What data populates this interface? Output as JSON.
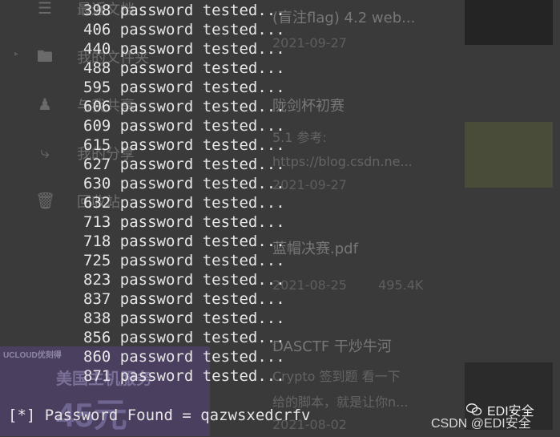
{
  "background": {
    "sidebar": {
      "items": [
        {
          "label": "最近文档",
          "icon": "layers-icon"
        },
        {
          "label": "我的文件夹",
          "icon": "folder-icon"
        },
        {
          "label": "与我共享",
          "icon": "users-icon"
        },
        {
          "label": "我的分享",
          "icon": "share-icon"
        },
        {
          "label": "回收站",
          "icon": "trash-icon"
        }
      ]
    },
    "files": [
      {
        "title": "(盲注flag) 4.2 web...",
        "date": "2021-09-27"
      },
      {
        "title": "陇剑杯初赛",
        "subtitle": "5.1 参考:",
        "link": "https://blog.csdn.ne...",
        "date": "2021-09-27"
      },
      {
        "title": "蓝帽决赛.pdf",
        "date": "2021-08-25",
        "size": "495.4K"
      },
      {
        "title": "DASCTF 干炒牛河",
        "subtitle": "Crypto 签到题 看一下",
        "subtitle2": "给的脚本，就是让你n...",
        "date": "2021-08-02"
      }
    ],
    "ad": {
      "brand": "UCLOUD优刻得",
      "text": "美国主机服务",
      "price": "45元"
    }
  },
  "terminal": {
    "lines": [
      "398 password tested...",
      "406 password tested...",
      "440 password tested...",
      "488 password tested...",
      "595 password tested...",
      "606 password tested...",
      "609 password tested...",
      "615 password tested...",
      "627 password tested...",
      "630 password tested...",
      "632 password tested...",
      "713 password tested...",
      "718 password tested...",
      "725 password tested...",
      "823 password tested...",
      "837 password tested...",
      "838 password tested...",
      "856 password tested...",
      "860 password tested...",
      "871 password tested..."
    ],
    "result": "[*] Password Found = qazwsxedcrfv"
  },
  "watermark": {
    "account": "EDI安全",
    "csdn": "CSDN @EDI安全"
  }
}
